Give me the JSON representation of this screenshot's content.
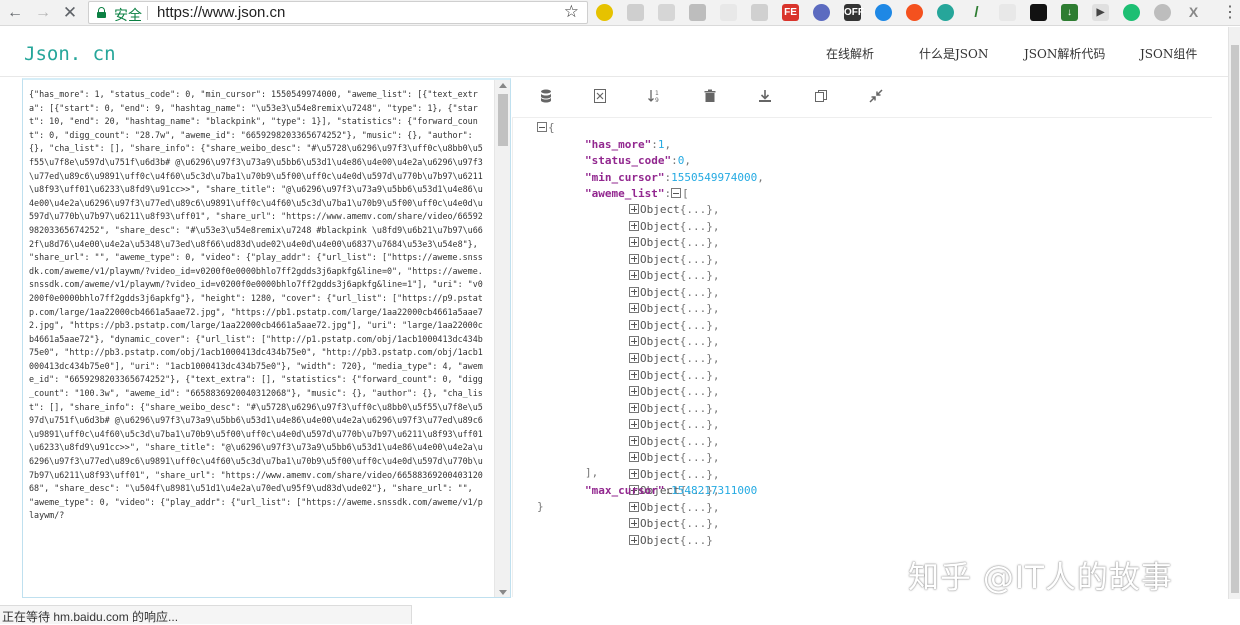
{
  "browser": {
    "url": "https://www.json.cn",
    "secure_label": "安全",
    "status_text": "正在等待 hm.baidu.com 的响应..."
  },
  "site": {
    "logo": "Json. cn",
    "nav": [
      "在线解析",
      "什么是JSON",
      "JSON解析代码",
      "JSON组件"
    ]
  },
  "editor": {
    "raw_text": "{\"has_more\": 1, \"status_code\": 0, \"min_cursor\": 1550549974000, \"aweme_list\": [{\"text_extra\": [{\"start\": 0, \"end\": 9, \"hashtag_name\": \"\\u53e3\\u54e8remix\\u7248\", \"type\": 1}, {\"start\": 10, \"end\": 20, \"hashtag_name\": \"blackpink\", \"type\": 1}], \"statistics\": {\"forward_count\": 0, \"digg_count\": \"28.7w\", \"aweme_id\": \"6659298203365674252\"}, \"music\": {}, \"author\": {}, \"cha_list\": [], \"share_info\": {\"share_weibo_desc\": \"#\\u5728\\u6296\\u97f3\\uff0c\\u8bb0\\u5f55\\u7f8e\\u597d\\u751f\\u6d3b# @\\u6296\\u97f3\\u73a9\\u5bb6\\u53d1\\u4e86\\u4e00\\u4e2a\\u6296\\u97f3\\u77ed\\u89c6\\u9891\\uff0c\\u4f60\\u5c3d\\u7ba1\\u70b9\\u5f00\\uff0c\\u4e0d\\u597d\\u770b\\u7b97\\u6211\\u8f93\\uff01\\u6233\\u8fd9\\u91cc>>\", \"share_title\": \"@\\u6296\\u97f3\\u73a9\\u5bb6\\u53d1\\u4e86\\u4e00\\u4e2a\\u6296\\u97f3\\u77ed\\u89c6\\u9891\\uff0c\\u4f60\\u5c3d\\u7ba1\\u70b9\\u5f00\\uff0c\\u4e0d\\u597d\\u770b\\u7b97\\u6211\\u8f93\\uff01\", \"share_url\": \"https://www.amemv.com/share/video/6659298203365674252\", \"share_desc\": \"#\\u53e3\\u54e8remix\\u7248 #blackpink \\u8fd9\\u6b21\\u7b97\\u662f\\u8d76\\u4e00\\u4e2a\\u5348\\u73ed\\u8f66\\ud83d\\ude02\\u4e0d\\u4e00\\u6837\\u7684\\u53e3\\u54e8\"}, \"share_url\": \"\", \"aweme_type\": 0, \"video\": {\"play_addr\": {\"url_list\": [\"https://aweme.snssdk.com/aweme/v1/playwm/?video_id=v0200f0e0000bhlo7ff2gdds3j6apkfg&line=0\", \"https://aweme.snssdk.com/aweme/v1/playwm/?video_id=v0200f0e0000bhlo7ff2gdds3j6apkfg&line=1\"], \"uri\": \"v0200f0e0000bhlo7ff2gdds3j6apkfg\"}, \"height\": 1280, \"cover\": {\"url_list\": [\"https://p9.pstatp.com/large/1aa22000cb4661a5aae72.jpg\", \"https://pb1.pstatp.com/large/1aa22000cb4661a5aae72.jpg\", \"https://pb3.pstatp.com/large/1aa22000cb4661a5aae72.jpg\"], \"uri\": \"large/1aa22000cb4661a5aae72\"}, \"dynamic_cover\": {\"url_list\": [\"http://p1.pstatp.com/obj/1acb1000413dc434b75e0\", \"http://pb3.pstatp.com/obj/1acb1000413dc434b75e0\", \"http://pb3.pstatp.com/obj/1acb1000413dc434b75e0\"], \"uri\": \"1acb1000413dc434b75e0\"}, \"width\": 720}, \"media_type\": 4, \"aweme_id\": \"6659298203365674252\"}, {\"text_extra\": [], \"statistics\": {\"forward_count\": 0, \"digg_count\": \"100.3w\", \"aweme_id\": \"6658836920040312068\"}, \"music\": {}, \"author\": {}, \"cha_list\": [], \"share_info\": {\"share_weibo_desc\": \"#\\u5728\\u6296\\u97f3\\uff0c\\u8bb0\\u5f55\\u7f8e\\u597d\\u751f\\u6d3b# @\\u6296\\u97f3\\u73a9\\u5bb6\\u53d1\\u4e86\\u4e00\\u4e2a\\u6296\\u97f3\\u77ed\\u89c6\\u9891\\uff0c\\u4f60\\u5c3d\\u7ba1\\u70b9\\u5f00\\uff0c\\u4e0d\\u597d\\u770b\\u7b97\\u6211\\u8f93\\uff01\\u6233\\u8fd9\\u91cc>>\", \"share_title\": \"@\\u6296\\u97f3\\u73a9\\u5bb6\\u53d1\\u4e86\\u4e00\\u4e2a\\u6296\\u97f3\\u77ed\\u89c6\\u9891\\uff0c\\u4f60\\u5c3d\\u7ba1\\u70b9\\u5f00\\uff0c\\u4e0d\\u597d\\u770b\\u7b97\\u6211\\u8f93\\uff01\", \"share_url\": \"https://www.amemv.com/share/video/6658836920040312068\", \"share_desc\": \"\\u504f\\u8981\\u51d1\\u4e2a\\u70ed\\u95f9\\ud83d\\ude02\"}, \"share_url\": \"\", \"aweme_type\": 0, \"video\": {\"play_addr\": {\"url_list\": [\"https://aweme.snssdk.com/aweme/v1/playwm/?"
  },
  "viewer": {
    "open_brace": "{",
    "has_more_key": "\"has_more\"",
    "has_more_value": "1",
    "status_code_key": "\"status_code\"",
    "status_code_value": "0",
    "min_cursor_key": "\"min_cursor\"",
    "min_cursor_value": "1550549974000",
    "aweme_list_key": "\"aweme_list\"",
    "object_label": "Object",
    "object_collapsed": "{...}",
    "object_count": 21,
    "close_bracket": "],",
    "max_cursor_key": "\"max_cursor\"",
    "max_cursor_value": "1548217311000",
    "close_brace": "}"
  },
  "watermark": "知乎 @IT人的故事",
  "colors": {
    "key": "#92278f",
    "number": "#25aae2",
    "logo": "#26a69a",
    "secure": "#0b8043"
  }
}
